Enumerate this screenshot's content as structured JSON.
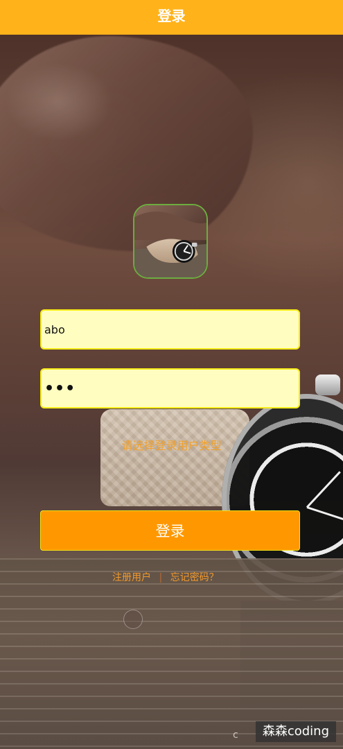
{
  "header": {
    "title": "登录"
  },
  "login_form": {
    "username_value": "abo",
    "password_value": "•••",
    "user_type_text": "请选择登录用户类型",
    "submit_label": "登录"
  },
  "links": {
    "register_label": "注册用户",
    "separator": "|",
    "forgot_label": "忘记密码？"
  },
  "watermark": {
    "text": "森森coding"
  },
  "edge_text": {
    "text": "c"
  },
  "icons": {
    "avatar": "watch-photo-icon",
    "loading": "loading-dot-icon"
  },
  "colors": {
    "header": "#ffb21a",
    "input_bg": "#fffec0",
    "input_border": "#f7ec16",
    "button": "#ff9800",
    "link": "#f39a2a",
    "watermark_bg": "#323232"
  }
}
